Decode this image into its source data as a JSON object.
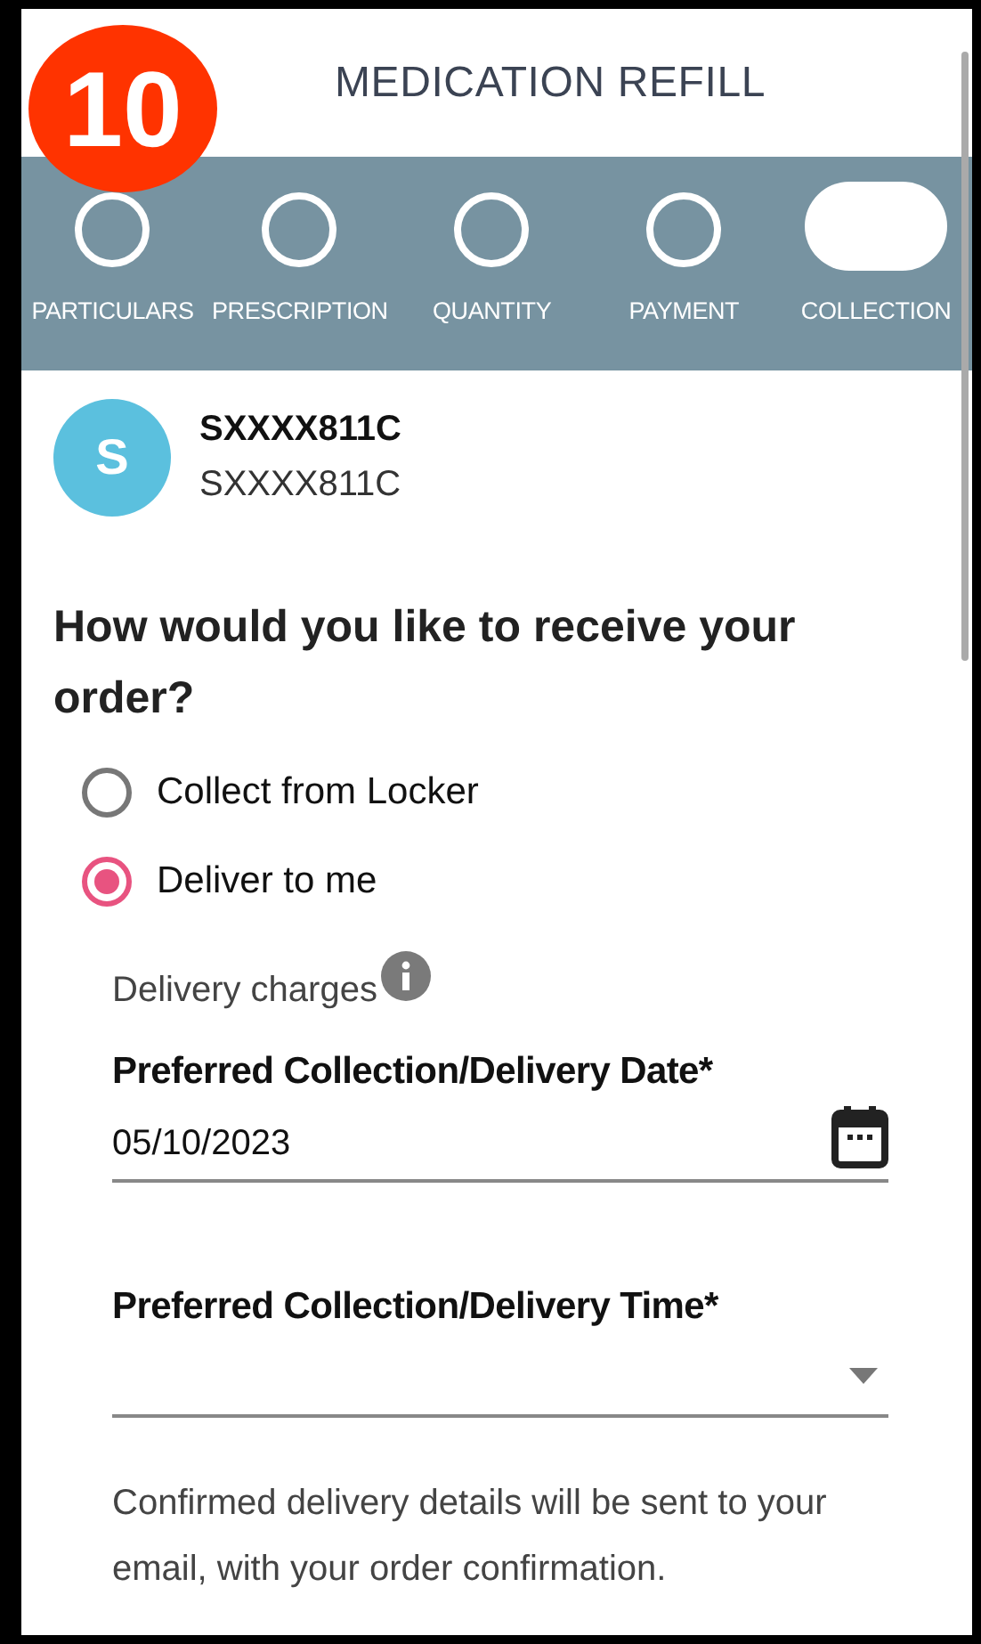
{
  "badge": "10",
  "title": "MEDICATION REFILL",
  "steps": [
    {
      "label": "PARTICULARS",
      "selected": false
    },
    {
      "label": "PRESCRIPTION",
      "selected": false
    },
    {
      "label": "QUANTITY",
      "selected": false
    },
    {
      "label": "PAYMENT",
      "selected": false
    },
    {
      "label": "COLLECTION",
      "selected": true
    }
  ],
  "profile": {
    "initial": "S",
    "name": "SXXXX811C",
    "id": "SXXXX811C"
  },
  "question": "How would you like to receive your order?",
  "options": [
    {
      "label": "Collect from Locker",
      "selected": false
    },
    {
      "label": "Deliver to me",
      "selected": true
    }
  ],
  "delivery_charges": "Delivery charges",
  "date_field": {
    "label": "Preferred Collection/Delivery Date*",
    "value": "05/10/2023"
  },
  "time_field": {
    "label": "Preferred Collection/Delivery Time*"
  },
  "note": "Confirmed delivery details will be sent to your email, with your order confirmation."
}
